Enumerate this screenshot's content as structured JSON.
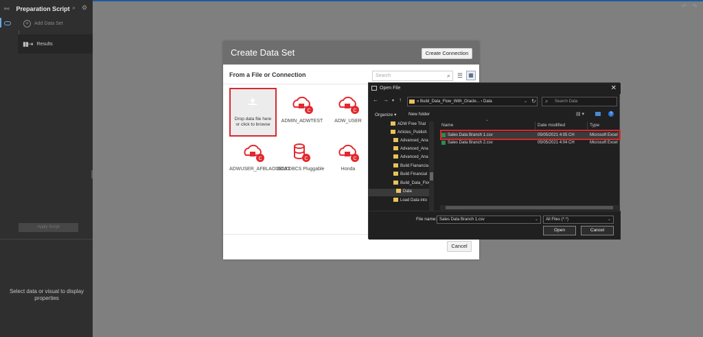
{
  "left_panel": {
    "title": "Preparation Script",
    "add_data_set": "Add Data Set",
    "results": "Results",
    "apply_script": "Apply Script",
    "properties_hint": "Select data or visual to display properties"
  },
  "create_dialog": {
    "title": "Create Data Set",
    "create_connection": "Create Connection",
    "subtitle": "From a File or Connection",
    "search_placeholder": "Search",
    "drop_text": "Drop data file here or click to browse",
    "connections": [
      "ADMIN_ADWTEST",
      "ADW_USER",
      "ADWUSER_AFBLAODEMO",
      "GC3 DBCS Pluggable",
      "Honda"
    ],
    "cancel": "Cancel"
  },
  "open_file": {
    "title": "Open File",
    "path": "« Build_Data_Flow_With_Oracle...  ›  Data",
    "search_placeholder": "Search Data",
    "organize": "Organize ▾",
    "new_folder": "New folder",
    "tree": [
      "ADW Free Trial",
      "Articles_Publish",
      "Advanced_Ana",
      "Advanced_Ana",
      "Advanced_Ana",
      "Build Fianancia",
      "Build Financial",
      "Build_Data_Flov",
      "Data",
      "Load Data into"
    ],
    "columns": {
      "name": "Name",
      "date": "Date modified",
      "type": "Type"
    },
    "files": [
      {
        "name": "Sales Data Branch 1.csv",
        "date": "05/05/2021 4:05 CH",
        "type": "Microsoft Excel"
      },
      {
        "name": "Sales Data Branch 2.csv",
        "date": "05/05/2021 4:04 CH",
        "type": "Microsoft Excel"
      }
    ],
    "file_name_label": "File name:",
    "file_name_value": "Sales Data Branch 1.csv",
    "file_type": "All Files (*.*)",
    "open": "Open",
    "cancel": "Cancel"
  },
  "colors": {
    "accent_red": "#d8282e",
    "oracle_red": "#e3282e",
    "panel_dark": "#2f2f2f"
  }
}
